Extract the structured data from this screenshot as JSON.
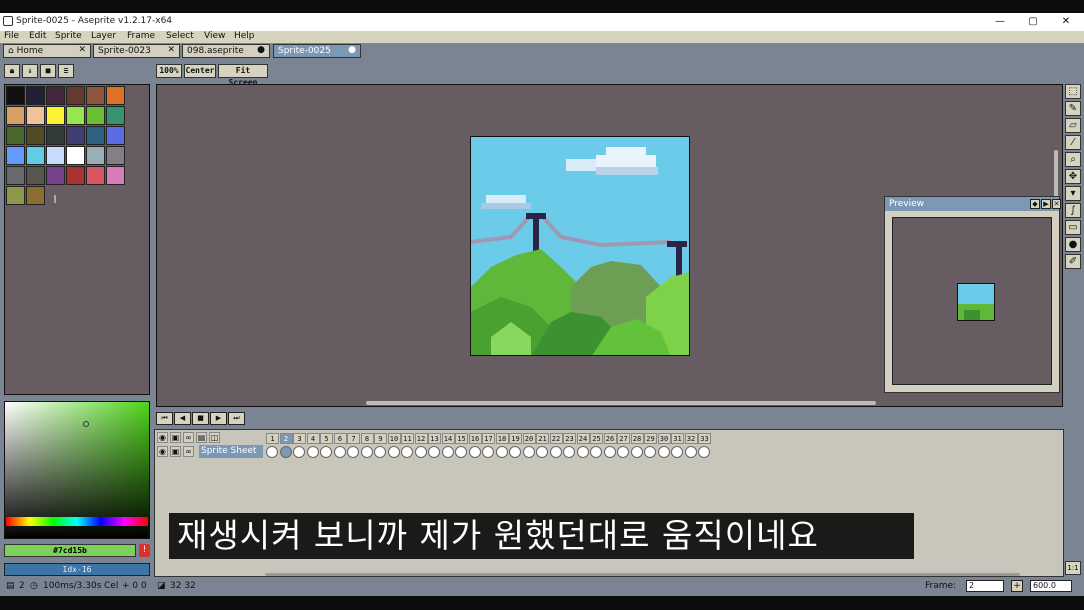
{
  "window": {
    "title": "Sprite-0025 - Aseprite v1.2.17-x64",
    "minimize": "—",
    "maximize": "▢",
    "close": "✕"
  },
  "menu": [
    "File",
    "Edit",
    "Sprite",
    "Layer",
    "Frame",
    "Select",
    "View",
    "Help"
  ],
  "tabs": [
    {
      "label": "Home",
      "icon": "home-icon",
      "close": "✕"
    },
    {
      "label": "Sprite-0023",
      "close": "✕"
    },
    {
      "label": "098.aseprite",
      "close": "●"
    },
    {
      "label": "Sprite-0025",
      "close": "●"
    }
  ],
  "palette_tools": [
    "lock-icon",
    "down-icon",
    "square-icon",
    "menu-icon"
  ],
  "canvas_buttons": {
    "zoom": "100%",
    "center": "Center",
    "fit": "Fit Screen"
  },
  "palette": [
    "#111111",
    "#222034",
    "#45283c",
    "#663931",
    "#8f563b",
    "#df7126",
    "#d9a066",
    "#eec39a",
    "#fbf236",
    "#99e550",
    "#6abe30",
    "#37946e",
    "#4b692f",
    "#524b24",
    "#323c39",
    "#3f3f74",
    "#306082",
    "#5b6ee1",
    "#639bff",
    "#5fcde4",
    "#cbdbfc",
    "#ffffff",
    "#9badb7",
    "#847e87",
    "#696a6a",
    "#595652",
    "#76428a",
    "#ac3232",
    "#d95763",
    "#d77bba",
    "#8f974a",
    "#8a6f30"
  ],
  "color": {
    "hex": "#7cd15b",
    "index": "Idx-16",
    "accent": "#7cd15b"
  },
  "preview": {
    "title": "Preview"
  },
  "tools": [
    "marquee-icon",
    "pencil-icon",
    "eraser-icon",
    "eyedropper-icon",
    "zoom-icon",
    "move-icon",
    "fill-icon",
    "curve-icon",
    "rect-icon",
    "blur-icon",
    "smudge-icon"
  ],
  "playback": [
    "⏮",
    "◀",
    "■",
    "▶",
    "⏭"
  ],
  "layer": {
    "name": "Sprite Sheet"
  },
  "frames": [
    "1",
    "2",
    "3",
    "4",
    "5",
    "6",
    "7",
    "8",
    "9",
    "10",
    "11",
    "12",
    "13",
    "14",
    "15",
    "16",
    "17",
    "18",
    "19",
    "20",
    "21",
    "22",
    "23",
    "24",
    "25",
    "26",
    "27",
    "28",
    "29",
    "30",
    "31",
    "32",
    "33"
  ],
  "current_frame": "2",
  "subtitle": "재생시켜 보니까 제가 원했던대로 움직이네요",
  "status": {
    "frame_info": "2",
    "duration": "100ms/3.30s",
    "cel": "Cel",
    "plus": "+ 0 0",
    "size": "32 32",
    "frame_label": "Frame:",
    "frame_value": "2",
    "zoom_value": "600.0",
    "onebyone": "1:1"
  }
}
